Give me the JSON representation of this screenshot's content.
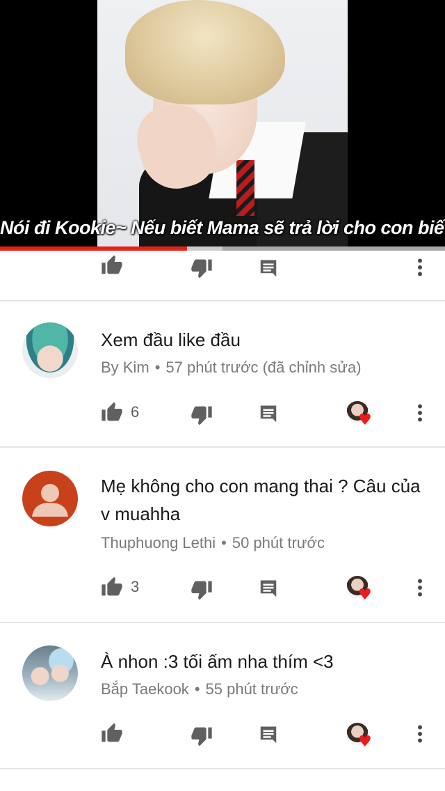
{
  "video": {
    "subtitle": "Nói đi Kookie~ Nếu biết Mama sẽ trả lời cho con biết",
    "progress_played": 0.42,
    "progress_buffered": 0.5
  },
  "colors": {
    "accent": "#e62117",
    "icon": "#606060",
    "meta_text": "#7a7a7a",
    "heart": "#ee1a1a"
  },
  "icons": {
    "like": "thumb-up-icon",
    "dislike": "thumb-down-icon",
    "reply": "comment-icon",
    "more": "more-vert-icon",
    "heart": "creator-heart-icon"
  },
  "comments": [
    {
      "text": "Xem đầu like đầu",
      "author": "By Kim",
      "time": "57 phút trước (đã chỉnh sửa)",
      "likes": "6"
    },
    {
      "text": "Mẹ không cho con mang thai ? Câu của v muahha",
      "author": "Thuphuong Lethi",
      "time": "50 phút trước",
      "likes": "3"
    },
    {
      "text": "À nhon :3 tối ấm nha thím <3",
      "author": "Bắp Taekook",
      "time": "55 phút trước",
      "likes": ""
    }
  ],
  "separator": "•",
  "heart_glyph": "♥"
}
